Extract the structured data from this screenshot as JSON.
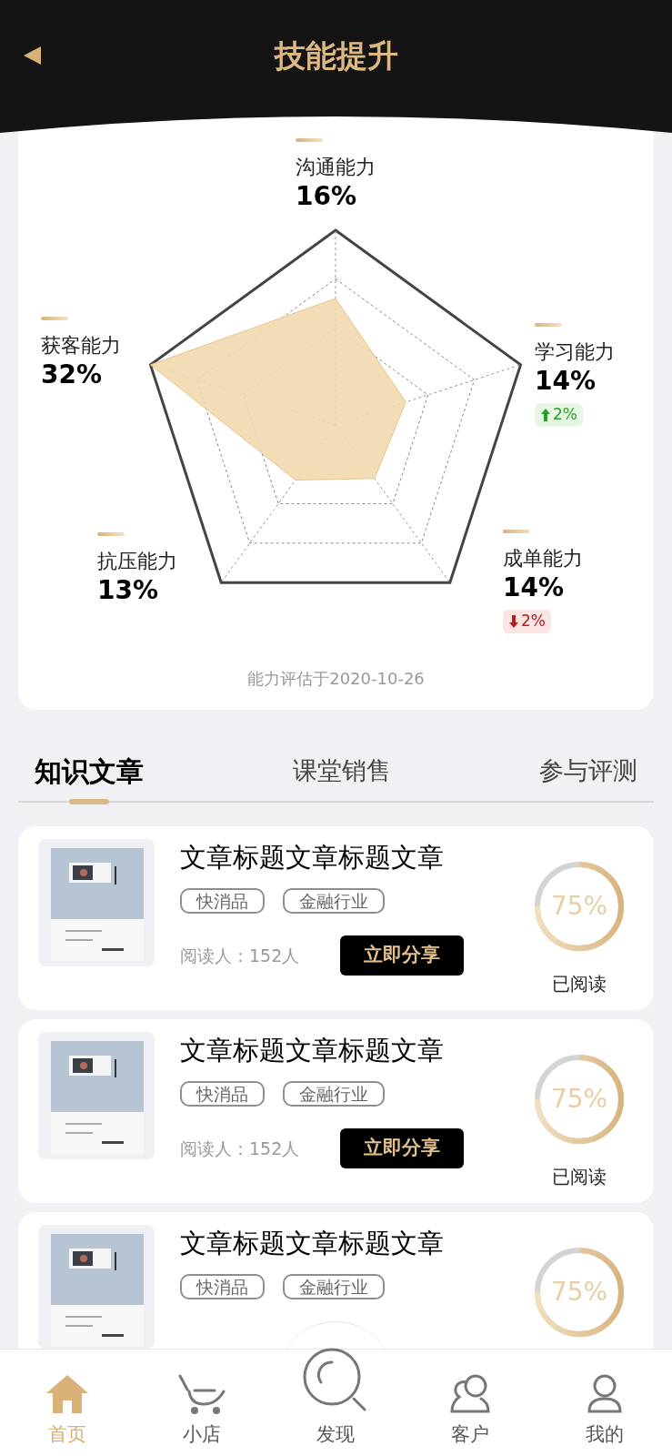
{
  "header": {
    "title": "技能提升"
  },
  "skills": {
    "items": [
      {
        "name": "沟通能力",
        "value": "16%"
      },
      {
        "name": "获客能力",
        "value": "32%"
      },
      {
        "name": "学习能力",
        "value": "14%",
        "delta": {
          "kind": "up",
          "text": "2%"
        }
      },
      {
        "name": "抗压能力",
        "value": "13%"
      },
      {
        "name": "成单能力",
        "value": "14%",
        "delta": {
          "kind": "down",
          "text": "2%"
        }
      }
    ],
    "date": "能力评估于2020-10-26"
  },
  "tabs": [
    {
      "label": "知识文章",
      "selected": true
    },
    {
      "label": "课堂销售",
      "selected": false
    },
    {
      "label": "参与评测",
      "selected": false
    }
  ],
  "articles": [
    {
      "title": "文章标题文章标题文章",
      "tags": [
        "快消品",
        "金融行业"
      ],
      "readers": "阅读人：152人",
      "share": "立即分享",
      "progress": "75%",
      "status": "已阅读"
    },
    {
      "title": "文章标题文章标题文章",
      "tags": [
        "快消品",
        "金融行业"
      ],
      "readers": "阅读人：152人",
      "share": "立即分享",
      "progress": "75%",
      "status": "已阅读"
    },
    {
      "title": "文章标题文章标题文章",
      "tags": [
        "快消品",
        "金融行业"
      ],
      "progress": "75%"
    }
  ],
  "nav": [
    {
      "label": "首页",
      "selected": true,
      "kind": "home"
    },
    {
      "label": "小店",
      "selected": false,
      "kind": "shop"
    },
    {
      "label": "发现",
      "selected": false,
      "kind": "discover"
    },
    {
      "label": "客户",
      "selected": false,
      "kind": "clients"
    },
    {
      "label": "我的",
      "selected": false,
      "kind": "me"
    }
  ]
}
